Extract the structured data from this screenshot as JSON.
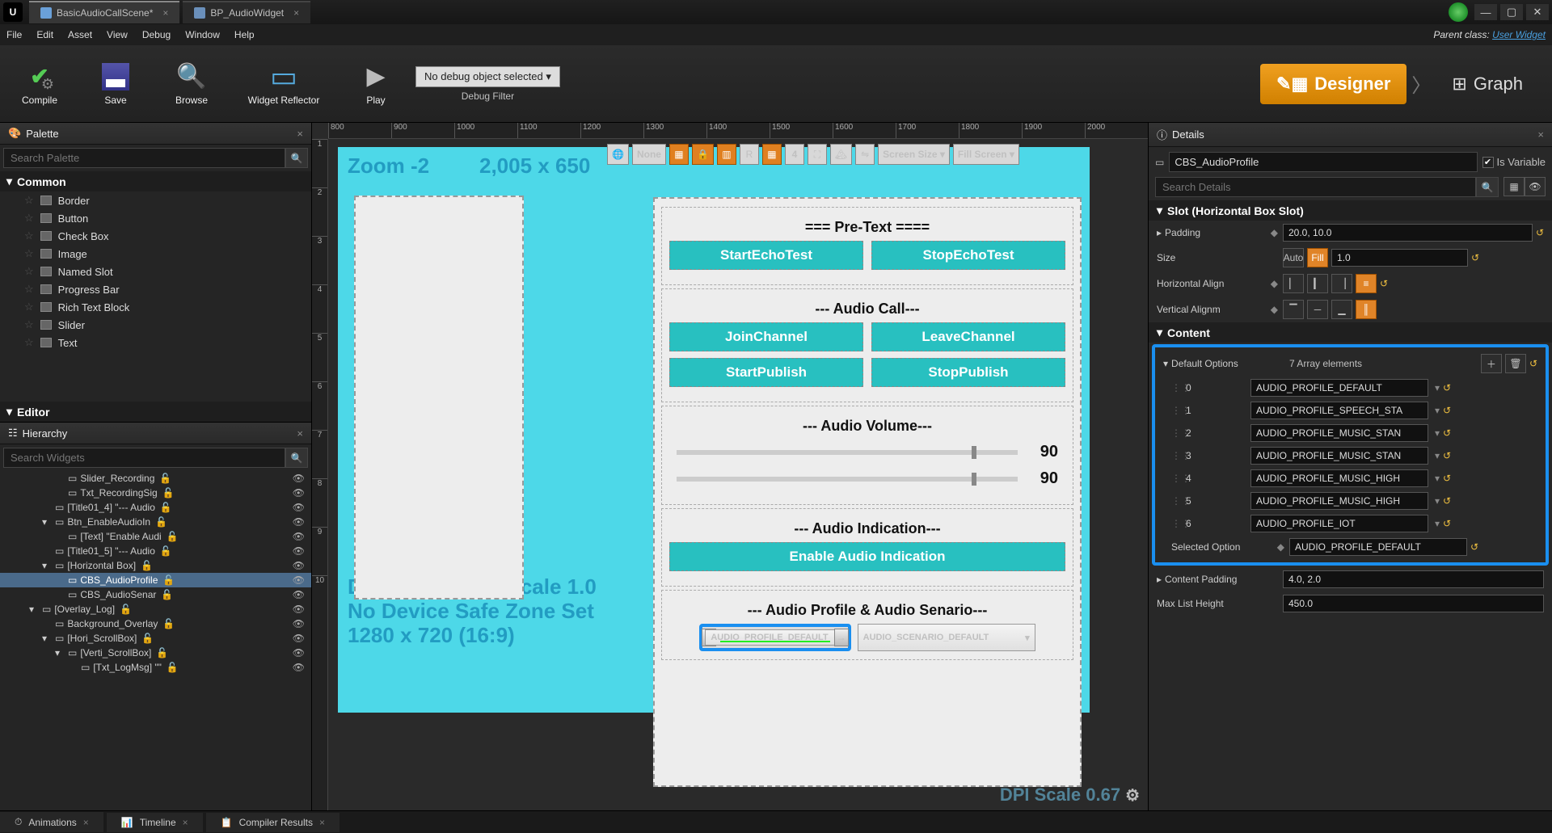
{
  "tabs": {
    "main": "BasicAudioCallScene*",
    "blueprint": "BP_AudioWidget"
  },
  "menu": {
    "file": "File",
    "edit": "Edit",
    "asset": "Asset",
    "view": "View",
    "debug": "Debug",
    "window": "Window",
    "help": "Help"
  },
  "parent": {
    "label": "Parent class:",
    "value": "User Widget"
  },
  "toolbar": {
    "compile": "Compile",
    "save": "Save",
    "browse": "Browse",
    "reflector": "Widget Reflector",
    "play": "Play",
    "debug_combo": "No debug object selected ▾",
    "debug_filter": "Debug Filter",
    "designer": "Designer",
    "graph": "Graph"
  },
  "palette": {
    "title": "Palette",
    "search_ph": "Search Palette",
    "cat_common": "Common",
    "items": [
      "Border",
      "Button",
      "Check Box",
      "Image",
      "Named Slot",
      "Progress Bar",
      "Rich Text Block",
      "Slider",
      "Text"
    ],
    "cat_editor": "Editor"
  },
  "hierarchy": {
    "title": "Hierarchy",
    "search_ph": "Search Widgets",
    "items": [
      {
        "ind": 3,
        "tri": "",
        "name": "Slider_Recording",
        "lock": true,
        "eye": true
      },
      {
        "ind": 3,
        "tri": "",
        "name": "Txt_RecordingSig",
        "lock": true,
        "eye": true
      },
      {
        "ind": 2,
        "tri": "",
        "name": "[Title01_4] \"--- Audio",
        "lock": true,
        "eye": true
      },
      {
        "ind": 2,
        "tri": "▾",
        "name": "Btn_EnableAudioIn",
        "lock": true,
        "eye": true
      },
      {
        "ind": 3,
        "tri": "",
        "name": "[Text] \"Enable Audi",
        "lock": true,
        "eye": true
      },
      {
        "ind": 2,
        "tri": "",
        "name": "[Title01_5] \"--- Audio",
        "lock": true,
        "eye": true
      },
      {
        "ind": 2,
        "tri": "▾",
        "name": "[Horizontal Box]",
        "lock": true,
        "eye": true
      },
      {
        "ind": 3,
        "tri": "",
        "name": "CBS_AudioProfile",
        "lock": true,
        "eye": true,
        "sel": true
      },
      {
        "ind": 3,
        "tri": "",
        "name": "CBS_AudioSenar",
        "lock": true,
        "eye": true
      },
      {
        "ind": 1,
        "tri": "▾",
        "name": "[Overlay_Log]",
        "lock": true,
        "eye": true
      },
      {
        "ind": 2,
        "tri": "",
        "name": "Background_Overlay",
        "lock": true,
        "eye": true
      },
      {
        "ind": 2,
        "tri": "▾",
        "name": "[Hori_ScrollBox]",
        "lock": true,
        "eye": true
      },
      {
        "ind": 3,
        "tri": "▾",
        "name": "[Verti_ScrollBox]",
        "lock": true,
        "eye": true
      },
      {
        "ind": 4,
        "tri": "",
        "name": "[Txt_LogMsg] \"\"",
        "lock": true,
        "eye": true
      }
    ]
  },
  "viewport": {
    "zoom": "Zoom -2",
    "dims": "2,005 x 650",
    "none_btn": "None",
    "screen_size": "Screen Size ▾",
    "fill_screen": "Fill Screen ▾",
    "grid_num": "4",
    "resolution_btn": "R",
    "ruler_h": [
      "800",
      "900",
      "1000",
      "1100",
      "1200",
      "1300",
      "1400",
      "1500",
      "1600",
      "1700",
      "1800",
      "1900",
      "2000"
    ],
    "ruler_v": [
      "1",
      "2",
      "3",
      "4",
      "5",
      "6",
      "7",
      "8",
      "9",
      "10"
    ],
    "content_scale": "Device Content Scale 1.0",
    "safe_zone": "No Device Safe Zone Set",
    "res": "1280 x 720 (16:9)",
    "dpi": "DPI Scale 0.67",
    "sections": {
      "pretext": "=== Pre-Text ====",
      "start_echo": "StartEchoTest",
      "stop_echo": "StopEchoTest",
      "audio_call": "--- Audio Call---",
      "join": "JoinChannel",
      "leave": "LeaveChannel",
      "start_pub": "StartPublish",
      "stop_pub": "StopPublish",
      "audio_vol": "--- Audio Volume---",
      "vol1": "90",
      "vol2": "90",
      "audio_ind": "--- Audio Indication---",
      "enable_ind": "Enable Audio Indication",
      "audio_prof": "--- Audio Profile & Audio Senario---",
      "profile_sel": "AUDIO_PROFILE_DEFAULT",
      "scenario_sel": "AUDIO_SCENARIO_DEFAULT"
    }
  },
  "details": {
    "title": "Details",
    "name": "CBS_AudioProfile",
    "is_variable": "Is Variable",
    "is_variable_checked": "✔",
    "search_ph": "Search Details",
    "slot_cat": "Slot (Horizontal Box Slot)",
    "padding_lbl": "Padding",
    "padding_val": "20.0, 10.0",
    "size_lbl": "Size",
    "size_auto": "Auto",
    "size_fill": "Fill",
    "size_val": "1.0",
    "halign_lbl": "Horizontal Align",
    "valign_lbl": "Vertical Alignm",
    "content_cat": "Content",
    "default_opts_lbl": "Default Options",
    "array_elements": "7 Array elements",
    "opts": [
      {
        "idx": "0",
        "val": "AUDIO_PROFILE_DEFAULT"
      },
      {
        "idx": "1",
        "val": "AUDIO_PROFILE_SPEECH_STA"
      },
      {
        "idx": "2",
        "val": "AUDIO_PROFILE_MUSIC_STAN"
      },
      {
        "idx": "3",
        "val": "AUDIO_PROFILE_MUSIC_STAN"
      },
      {
        "idx": "4",
        "val": "AUDIO_PROFILE_MUSIC_HIGH"
      },
      {
        "idx": "5",
        "val": "AUDIO_PROFILE_MUSIC_HIGH"
      },
      {
        "idx": "6",
        "val": "AUDIO_PROFILE_IOT"
      }
    ],
    "selected_lbl": "Selected Option",
    "selected_val": "AUDIO_PROFILE_DEFAULT",
    "content_padding_lbl": "Content Padding",
    "content_padding_val": "4.0, 2.0",
    "max_list_lbl": "Max List Height",
    "max_list_val": "450.0"
  },
  "bottom": {
    "anim": "Animations",
    "timeline": "Timeline",
    "compiler": "Compiler Results"
  }
}
